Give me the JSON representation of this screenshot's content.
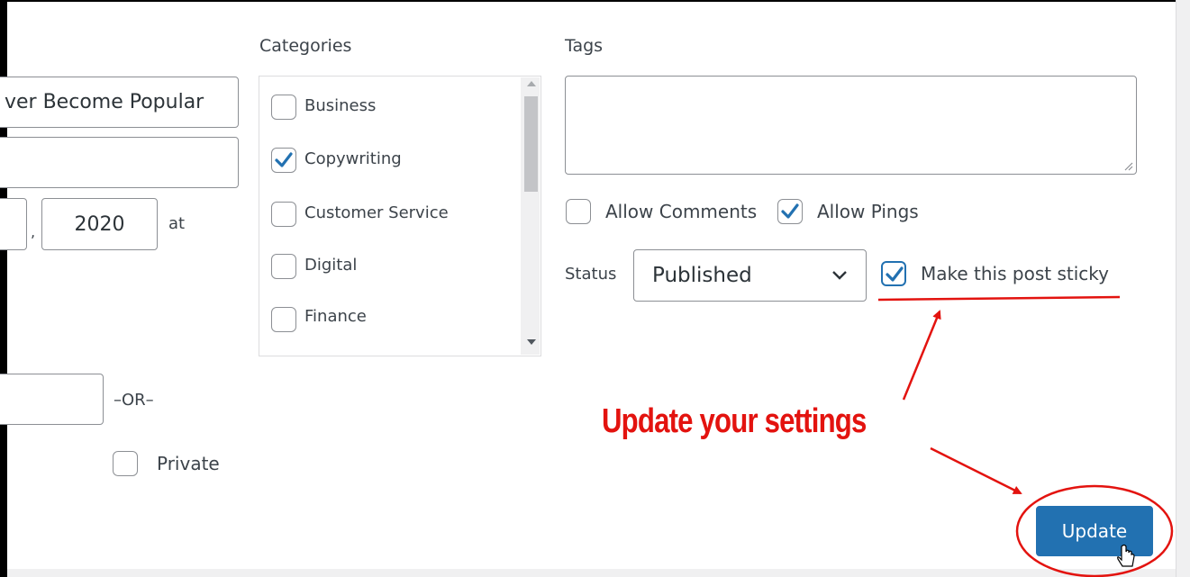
{
  "categories": {
    "heading": "Categories",
    "items": [
      {
        "label": "Business",
        "checked": false
      },
      {
        "label": "Copywriting",
        "checked": true
      },
      {
        "label": "Customer Service",
        "checked": false
      },
      {
        "label": "Digital",
        "checked": false
      },
      {
        "label": "Finance",
        "checked": false
      }
    ]
  },
  "tags": {
    "heading": "Tags",
    "value": ""
  },
  "left_fields": {
    "title_value": "ver Become Popular",
    "slug_value": "",
    "date_separator": ",",
    "year_value": "2020",
    "at_label": "at",
    "password_value": "",
    "or_label": "–OR–",
    "private_label": "Private"
  },
  "options": {
    "allow_comments_label": "Allow Comments",
    "allow_comments_checked": false,
    "allow_pings_label": "Allow Pings",
    "allow_pings_checked": true,
    "status_label": "Status",
    "status_value": "Published",
    "sticky_label": "Make this post sticky",
    "sticky_checked": true
  },
  "actions": {
    "update_label": "Update"
  },
  "annotation": {
    "text": "Update your settings",
    "color": "#e3130f"
  },
  "colors": {
    "accent": "#2271b1",
    "check": "#2271b1",
    "annotation": "#e3130f"
  }
}
